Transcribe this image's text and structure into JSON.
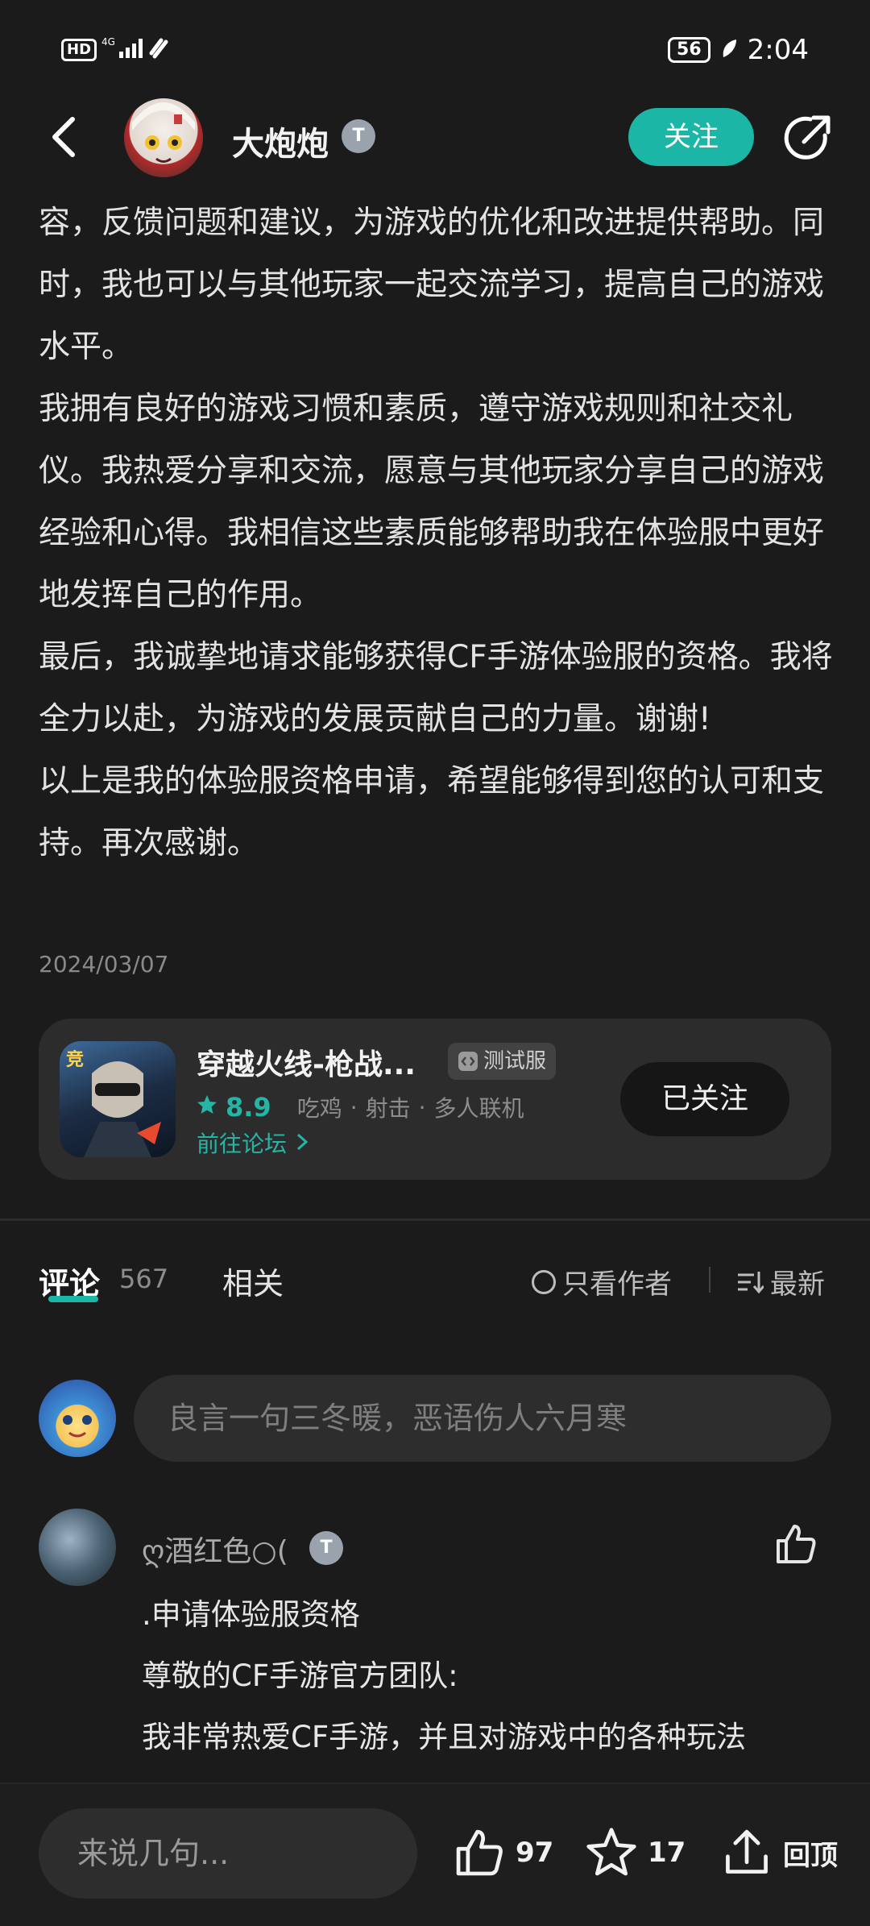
{
  "status_bar": {
    "left_icons": "HD 4G",
    "battery": "56",
    "time": "2:04"
  },
  "header": {
    "username": "大炮炮",
    "badge": "T",
    "follow_label": "关注"
  },
  "article": {
    "paragraphs": [
      "容，反馈问题和建议，为游戏的优化和改进提供帮助。同时，我也可以与其他玩家一起交流学习，提高自己的游戏水平。",
      "我拥有良好的游戏习惯和素质，遵守游戏规则和社交礼仪。我热爱分享和交流，愿意与其他玩家分享自己的游戏经验和心得。我相信这些素质能够帮助我在体验服中更好地发挥自己的作用。",
      "最后，我诚挚地请求能够获得CF手游体验服的资格。我将全力以赴，为游戏的发展贡献自己的力量。谢谢!",
      "以上是我的体验服资格申请，希望能够得到您的认可和支持。再次感谢。"
    ],
    "date": "2024/03/07"
  },
  "game_card": {
    "title": "穿越火线-枪战...",
    "test_tag": "测试服",
    "rating": "8.9",
    "tags": [
      "吃鸡",
      "射击",
      "多人联机"
    ],
    "forum_link": "前往论坛",
    "followed_label": "已关注"
  },
  "tabs": {
    "comment_label": "评论",
    "comment_count": "567",
    "related_label": "相关",
    "only_author_label": "只看作者",
    "sort_label": "最新"
  },
  "comment_input": {
    "placeholder": "良言一句三冬暖，恶语伤人六月寒"
  },
  "comment": {
    "author": "ღ酒红色○(",
    "badge": "T",
    "paragraphs": [
      ".申请体验服资格",
      "尊敬的CF手游官方团队:",
      "我非常热爱CF手游，并且对游戏中的各种玩法"
    ]
  },
  "bottom_bar": {
    "input_placeholder": "来说几句...",
    "like_count": "97",
    "star_count": "17",
    "top_label": "回顶"
  },
  "colors": {
    "accent": "#1bb6a6",
    "background": "#1b1b1b",
    "card": "#2c2c2c"
  }
}
